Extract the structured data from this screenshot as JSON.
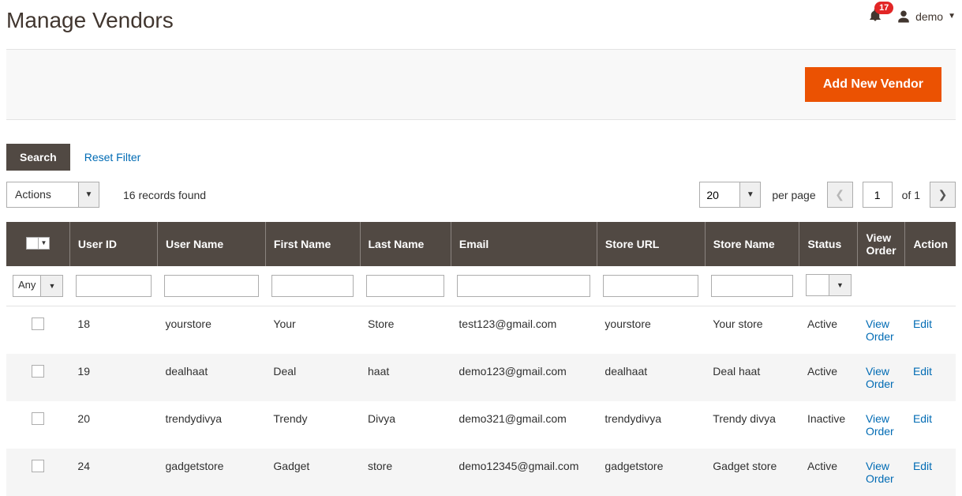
{
  "header": {
    "title": "Manage Vendors",
    "notification_count": "17",
    "username": "demo"
  },
  "actionbar": {
    "add_vendor": "Add New Vendor"
  },
  "filterbar": {
    "search": "Search",
    "reset": "Reset Filter"
  },
  "controls": {
    "actions_label": "Actions",
    "records_found": "16 records found",
    "page_size": "20",
    "per_page": "per page",
    "current_page": "1",
    "page_of": "of 1"
  },
  "table": {
    "headers": {
      "user_id": "User ID",
      "user_name": "User Name",
      "first_name": "First Name",
      "last_name": "Last Name",
      "email": "Email",
      "store_url": "Store URL",
      "store_name": "Store Name",
      "status": "Status",
      "view_order": "View Order",
      "action": "Action"
    },
    "filter_any": "Any",
    "view_order_link": "View Order",
    "edit_link": "Edit",
    "rows": [
      {
        "user_id": "18",
        "user_name": "yourstore",
        "first_name": "Your",
        "last_name": "Store",
        "email": "test123@gmail.com",
        "store_url": "yourstore",
        "store_name": "Your store",
        "status": "Active"
      },
      {
        "user_id": "19",
        "user_name": "dealhaat",
        "first_name": "Deal",
        "last_name": "haat",
        "email": "demo123@gmail.com",
        "store_url": "dealhaat",
        "store_name": "Deal haat",
        "status": "Active"
      },
      {
        "user_id": "20",
        "user_name": "trendydivya",
        "first_name": "Trendy",
        "last_name": "Divya",
        "email": "demo321@gmail.com",
        "store_url": "trendydivya",
        "store_name": "Trendy divya",
        "status": "Inactive"
      },
      {
        "user_id": "24",
        "user_name": "gadgetstore",
        "first_name": "Gadget",
        "last_name": "store",
        "email": "demo12345@gmail.com",
        "store_url": "gadgetstore",
        "store_name": "Gadget store",
        "status": "Active"
      }
    ]
  }
}
